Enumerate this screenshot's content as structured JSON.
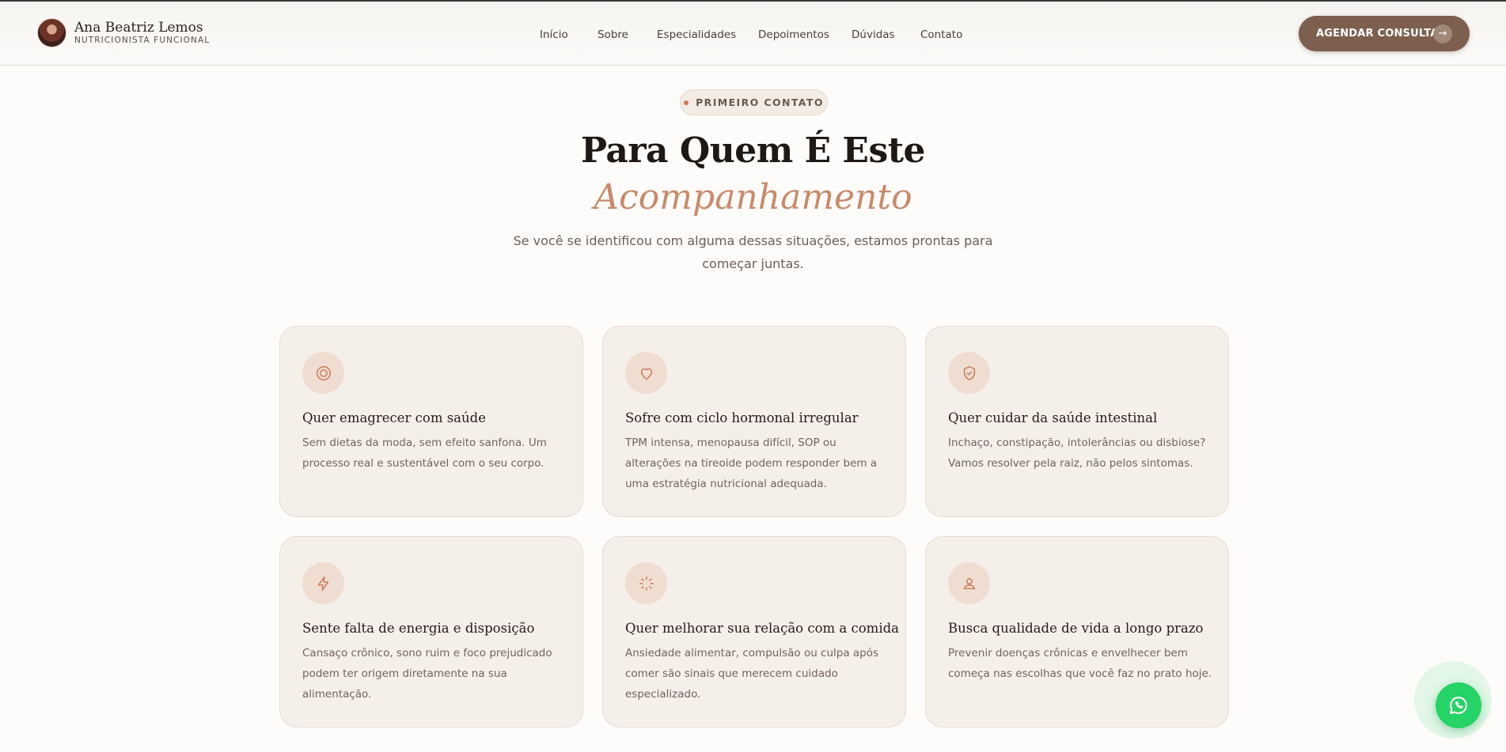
{
  "brand": {
    "name": "Ana Beatriz Lemos",
    "subtitle": "NUTRICIONISTA FUNCIONAL"
  },
  "nav": {
    "items": [
      {
        "label": "Início"
      },
      {
        "label": "Sobre"
      },
      {
        "label": "Especialidades"
      },
      {
        "label": "Depoimentos"
      },
      {
        "label": "Dúvidas"
      },
      {
        "label": "Contato"
      }
    ]
  },
  "cta": {
    "label": "AGENDAR CONSULTA",
    "arrow": "→"
  },
  "section": {
    "badge": "PRIMEIRO CONTATO",
    "title": "Para Quem É Este",
    "title_accent": "Acompanhamento",
    "lead": "Se você se identificou com alguma dessas situações, estamos prontas para começar juntas."
  },
  "cards": [
    {
      "icon": "target-icon",
      "title": "Quer emagrecer com saúde",
      "desc": "Sem dietas da moda, sem efeito sanfona. Um processo real e sustentável com o seu corpo."
    },
    {
      "icon": "heart-icon",
      "title": "Sofre com ciclo hormonal irregular",
      "desc": "TPM intensa, menopausa difícil, SOP ou alterações na tireoide podem responder bem a uma estratégia nutricional adequada."
    },
    {
      "icon": "shield-check-icon",
      "title": "Quer cuidar da saúde intestinal",
      "desc": "Inchaço, constipação, intolerâncias ou disbiose? Vamos resolver pela raiz, não pelos sintomas."
    },
    {
      "icon": "lightning-icon",
      "title": "Sente falta de energia e disposição",
      "desc": "Cansaço crônico, sono ruim e foco prejudicado podem ter origem diretamente na sua alimentação."
    },
    {
      "icon": "loader-icon",
      "title": "Quer melhorar sua relação com a comida",
      "desc": "Ansiedade alimentar, compulsão ou culpa após comer são sinais que merecem cuidado especializado."
    },
    {
      "icon": "user-icon",
      "title": "Busca qualidade de vida a longo prazo",
      "desc": "Prevenir doenças crônicas e envelhecer bem começa nas escolhas que você faz no prato hoje."
    }
  ],
  "colors": {
    "accent": "#c98a6a",
    "cta_bg": "#7c5f4f",
    "card_bg": "#f5efe9",
    "whatsapp": "#25d366"
  },
  "whatsapp": {
    "icon": "whatsapp-icon"
  }
}
